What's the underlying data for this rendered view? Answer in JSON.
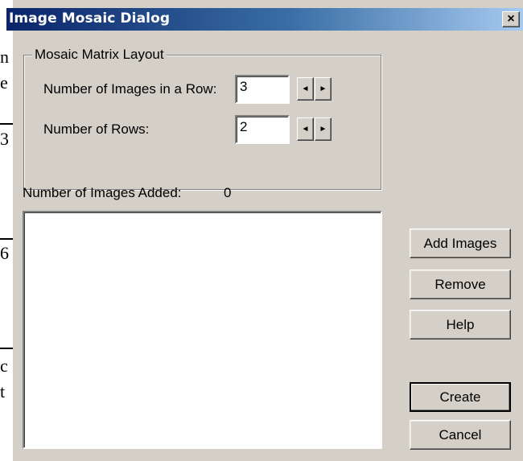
{
  "dialog": {
    "title": "Image Mosaic Dialog",
    "close_glyph": "×"
  },
  "layout_group": {
    "legend": "Mosaic Matrix Layout",
    "images_per_row_label": "Number of Images in a Row:",
    "images_per_row_value": "3",
    "rows_label": "Number of Rows:",
    "rows_value": "2",
    "spin_left_glyph": "◄",
    "spin_right_glyph": "►"
  },
  "images_added": {
    "label": "Number of Images Added:",
    "count": "0"
  },
  "buttons": {
    "add_images": "Add Images",
    "remove": "Remove",
    "help": "Help",
    "create": "Create",
    "cancel": "Cancel"
  },
  "background_fragments": [
    "n",
    "e",
    "3",
    "6",
    "c",
    "t"
  ]
}
